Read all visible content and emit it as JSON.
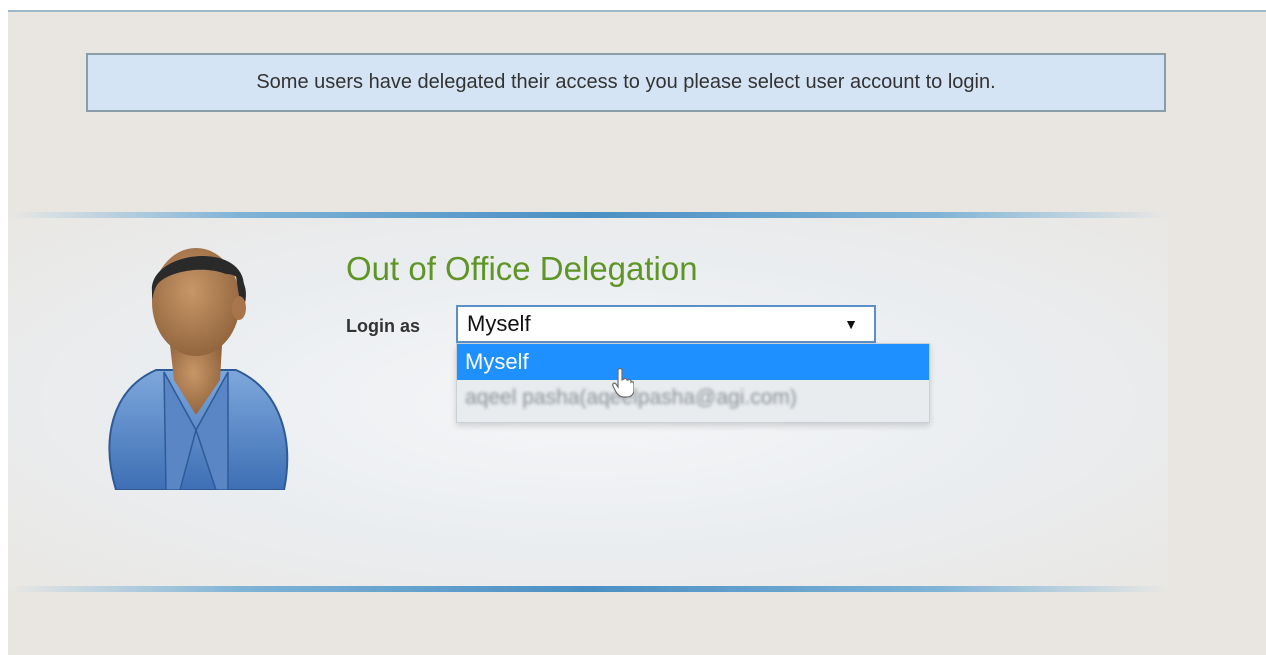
{
  "notice": {
    "text": "Some users have delegated their access to you please select user account to login."
  },
  "delegation": {
    "title": "Out of Office Delegation",
    "login_label": "Login as",
    "select": {
      "value": "Myself",
      "arrow": "▼"
    },
    "options": [
      {
        "label": "Myself",
        "highlighted": true
      },
      {
        "label": "aqeel pasha(aqeelpasha@agi.com)",
        "highlighted": false
      }
    ]
  },
  "icons": {
    "avatar": "user-avatar-icon",
    "arrow": "dropdown-arrow-icon",
    "cursor": "hand-cursor-icon"
  },
  "colors": {
    "title": "#5f9526",
    "notice_bg": "#d4e4f4",
    "highlight": "#1e90ff",
    "accent_rule": "#4a8fc4"
  }
}
